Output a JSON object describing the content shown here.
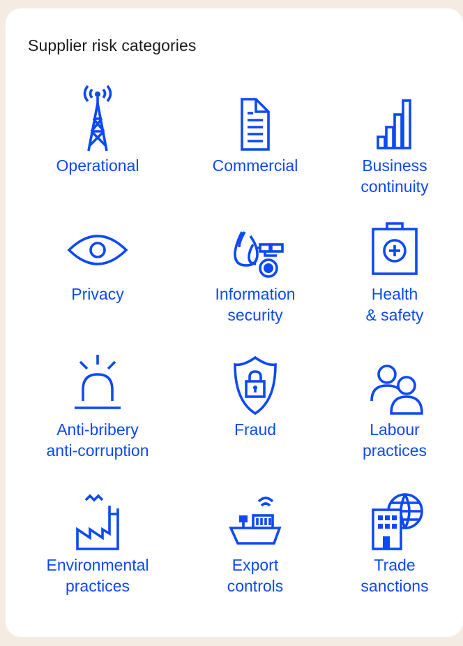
{
  "title": "Supplier risk categories",
  "colors": {
    "background": "#f4ece2",
    "card": "#ffffff",
    "accent": "#0d49f5",
    "title": "#1b1b1b"
  },
  "categories": [
    {
      "icon": "radio-tower-icon",
      "label_lines": [
        "Operational"
      ]
    },
    {
      "icon": "document-icon",
      "label_lines": [
        "Commercial"
      ]
    },
    {
      "icon": "bar-chart-icon",
      "label_lines": [
        "Business",
        "continuity"
      ]
    },
    {
      "icon": "eye-icon",
      "label_lines": [
        "Privacy"
      ]
    },
    {
      "icon": "data-drops-network-icon",
      "label_lines": [
        "Information",
        "security"
      ]
    },
    {
      "icon": "first-aid-kit-icon",
      "label_lines": [
        "Health",
        "& safety"
      ]
    },
    {
      "icon": "alarm-siren-icon",
      "label_lines": [
        "Anti-bribery",
        "anti-corruption"
      ]
    },
    {
      "icon": "shield-lock-icon",
      "label_lines": [
        "Fraud"
      ]
    },
    {
      "icon": "people-icon",
      "label_lines": [
        "Labour",
        "practices"
      ]
    },
    {
      "icon": "factory-icon",
      "label_lines": [
        "Environmental",
        "practices"
      ]
    },
    {
      "icon": "cargo-ship-icon",
      "label_lines": [
        "Export",
        "controls"
      ]
    },
    {
      "icon": "globe-building-icon",
      "label_lines": [
        "Trade",
        "sanctions"
      ]
    }
  ]
}
